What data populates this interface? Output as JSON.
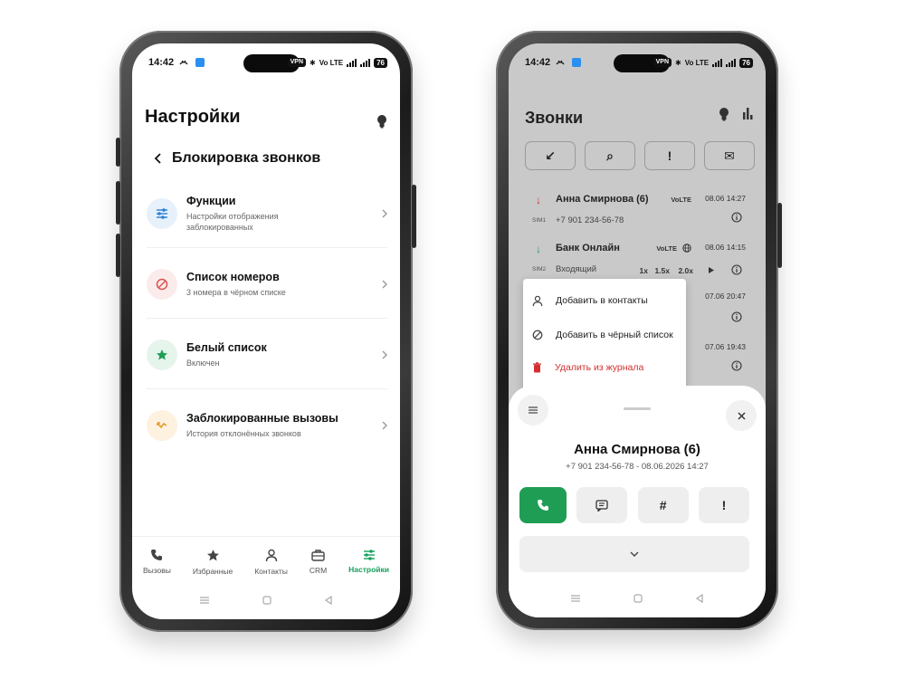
{
  "status": {
    "time": "14:42",
    "vpn": "VPN",
    "volte": "Vo LTE",
    "battery": "76"
  },
  "left": {
    "title": "Настройки",
    "subtitle": "Блокировка звонков",
    "items": [
      {
        "title": "Функции",
        "sub": "Настройки отображения заблокированных",
        "icon": "sliders-icon",
        "color": "#2a7fd4",
        "bg": "#e7f1fb"
      },
      {
        "title": "Список номеров",
        "sub": "3 номера в чёрном списке",
        "icon": "block-icon",
        "color": "#d9534f",
        "bg": "#fcebeb"
      },
      {
        "title": "Белый список",
        "sub": "Включен",
        "icon": "star-icon",
        "color": "#1f9d55",
        "bg": "#e6f5ec"
      },
      {
        "title": "Заблокированные вызовы",
        "sub": "История отклонённых звонков",
        "icon": "missed-call-icon",
        "color": "#e49a2b",
        "bg": "#fdf1e0"
      }
    ],
    "nav": [
      {
        "label": "Вызовы",
        "icon": "phone-icon"
      },
      {
        "label": "Избранные",
        "icon": "star-icon"
      },
      {
        "label": "Контакты",
        "icon": "person-icon"
      },
      {
        "label": "CRM",
        "icon": "briefcase-icon"
      },
      {
        "label": "Настройки",
        "icon": "sliders-icon",
        "active": true
      }
    ]
  },
  "right": {
    "title": "Звонки",
    "filters": [
      "↙",
      "⌕",
      "!",
      "✉"
    ],
    "calls": [
      {
        "name": "Анна Смирнова (6)",
        "number": "+7 901 234-56-78",
        "sim": "SIM1",
        "volte": "VoLTE",
        "date": "08.06 14:27",
        "direction": "↓",
        "dir_color": "#d32f2f"
      },
      {
        "name": "Банк Онлайн",
        "number": "Входящий",
        "sim": "SIM2",
        "volte": "VoLTE",
        "date": "08.06 14:15",
        "direction": "↓",
        "dir_color": "#1f9d55",
        "speeds": [
          "1x",
          "1.5x",
          "2.0x"
        ]
      },
      {
        "date": "07.06 20:47"
      },
      {
        "date": "07.06 19:43"
      }
    ],
    "context_menu": [
      {
        "label": "Добавить в контакты",
        "icon": "person-icon"
      },
      {
        "label": "Добавить в чёрный список",
        "icon": "block-icon"
      },
      {
        "label": "Удалить из журнала",
        "icon": "trash-icon",
        "danger": true
      }
    ],
    "sheet": {
      "name": "Анна Смирнова (6)",
      "meta": "+7 901 234-56-78 - 08.06.2026 14:27",
      "actions": [
        "call",
        "message",
        "#",
        "!"
      ]
    }
  }
}
